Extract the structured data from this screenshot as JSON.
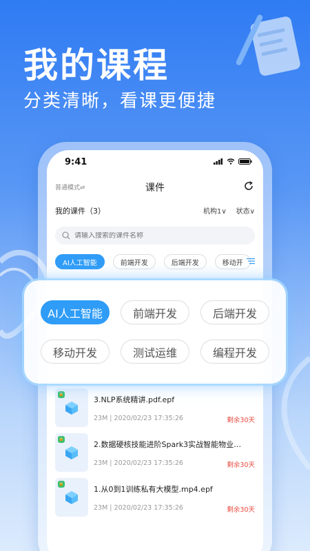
{
  "hero": {
    "title": "我的课程",
    "subtitle": "分类清晰，看课更便捷"
  },
  "status": {
    "time": "9:41"
  },
  "nav": {
    "mode_label": "普通模式⇌",
    "title": "课件"
  },
  "filter_bar": {
    "count_label": "我的课件（3）",
    "org_filter": "机构1∨",
    "status_filter": "状态∨"
  },
  "search": {
    "placeholder": "请输入搜索的课件名称"
  },
  "category_tags": [
    {
      "label": "AI人工智能",
      "active": true
    },
    {
      "label": "前端开发",
      "active": false
    },
    {
      "label": "后端开发",
      "active": false
    },
    {
      "label": "移动开"
    }
  ],
  "popup_tags": [
    {
      "label": "AI人工智能",
      "active": true
    },
    {
      "label": "前端开发"
    },
    {
      "label": "后端开发"
    },
    {
      "label": "移动开发"
    },
    {
      "label": "测试运维"
    },
    {
      "label": "编程开发"
    }
  ],
  "courses": [
    {
      "title": "3.NLP系统精讲.pdf.epf",
      "meta": "23M | 2020/02/23 17:35:26",
      "remain": "剩余30天"
    },
    {
      "title": "2.数据硬核技能进阶Spark3实战智能物业…",
      "meta": "23M | 2020/02/23 17:35:26",
      "remain": "剩余30天"
    },
    {
      "title": "1.从0到1训练私有大模型.mp4.epf",
      "meta": "23M | 2020/02/23 17:35:26",
      "remain": "剩余30天"
    }
  ],
  "colors": {
    "accent": "#2f9cf7",
    "danger": "#e8483c",
    "lock": "#3ac06e"
  }
}
